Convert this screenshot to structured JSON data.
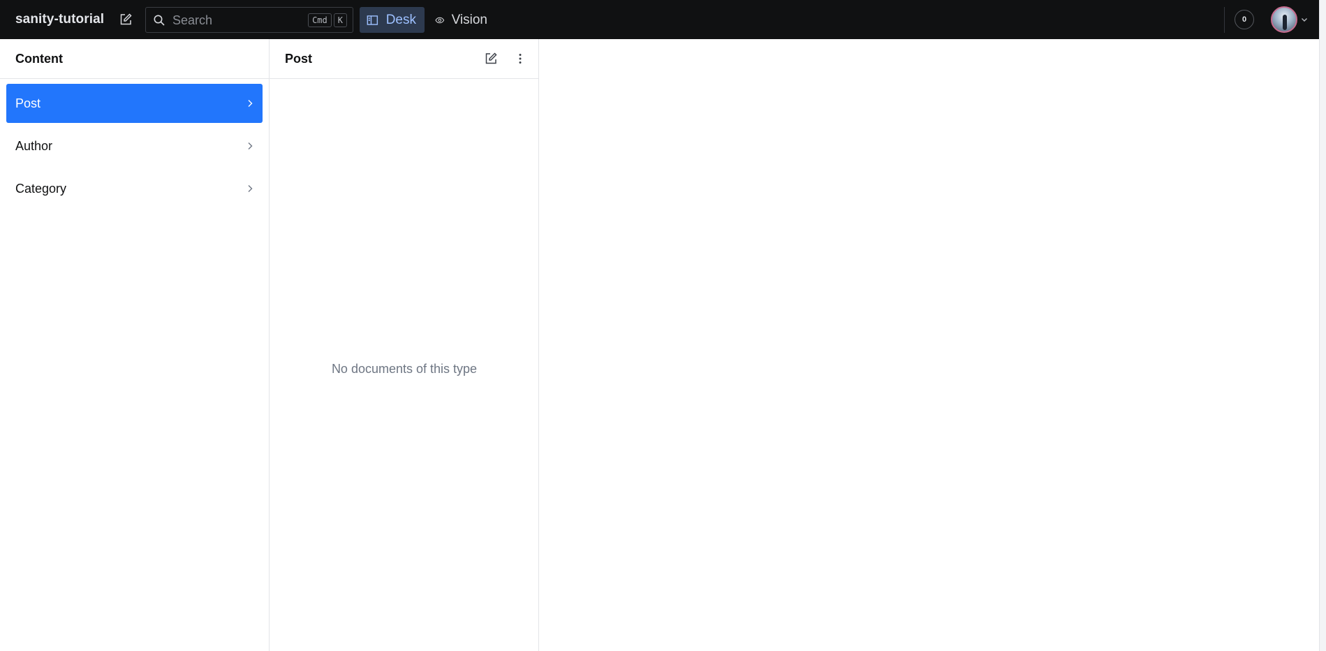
{
  "app": {
    "project_name": "sanity-tutorial"
  },
  "navbar": {
    "search": {
      "placeholder": "Search",
      "shortcut_keys": [
        "Cmd",
        "K"
      ]
    },
    "tools": [
      {
        "label": "Desk",
        "icon": "desk-icon",
        "active": true
      },
      {
        "label": "Vision",
        "icon": "eye-icon",
        "active": false
      }
    ],
    "notification_count": "0",
    "user_avatar": "avatar"
  },
  "panes": {
    "content": {
      "title": "Content",
      "items": [
        {
          "label": "Post",
          "selected": true
        },
        {
          "label": "Author",
          "selected": false
        },
        {
          "label": "Category",
          "selected": false
        }
      ]
    },
    "post": {
      "title": "Post",
      "empty_message": "No documents of this type"
    }
  },
  "colors": {
    "navbar_bg": "#101112",
    "accent": "#2276fc",
    "active_tool_bg": "#2d3a4f",
    "active_tool_text": "#9dc0ff",
    "muted_text": "#6e7683"
  }
}
